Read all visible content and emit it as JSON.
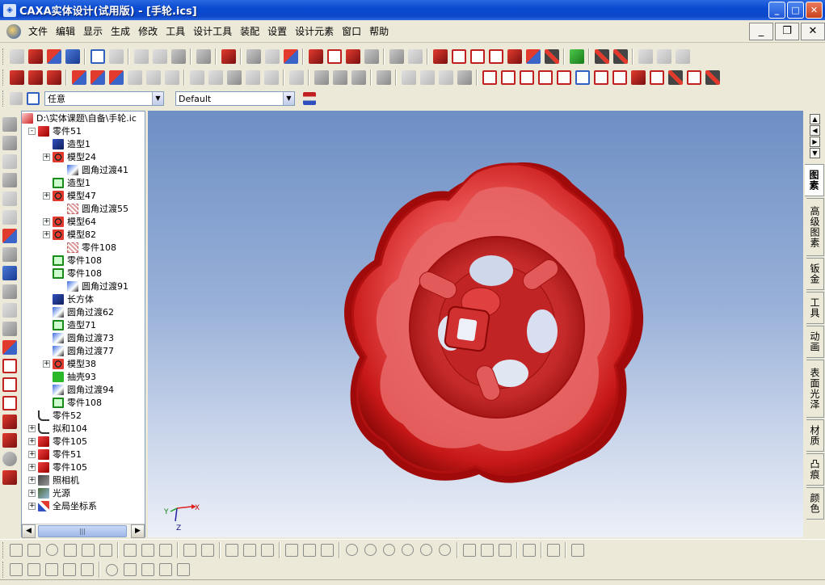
{
  "window": {
    "title": "CAXA实体设计(试用版) - [手轮.ics]",
    "app_icon": "caxa-app-icon",
    "controls": [
      "minimize",
      "maximize",
      "close"
    ]
  },
  "menu": {
    "items": [
      "文件",
      "编辑",
      "显示",
      "生成",
      "修改",
      "工具",
      "设计工具",
      "装配",
      "设置",
      "设计元素",
      "窗口",
      "帮助"
    ],
    "mdi_controls": [
      "minimize",
      "restore",
      "close"
    ]
  },
  "selectors": {
    "filter_value": "任意",
    "style_value": "Default"
  },
  "tree": {
    "root_label": "D:\\实体课题\\自备\\手轮.ic",
    "nodes": [
      {
        "label": "零件51",
        "icon": "part",
        "expand": "-"
      },
      {
        "label": "造型1",
        "icon": "proto",
        "expand": ""
      },
      {
        "label": "模型24",
        "icon": "model",
        "expand": "+"
      },
      {
        "label": "圆角过渡41",
        "icon": "fillet",
        "expand": ""
      },
      {
        "label": "造型1",
        "icon": "box",
        "expand": ""
      },
      {
        "label": "模型47",
        "icon": "model",
        "expand": "+"
      },
      {
        "label": "圆角过渡55",
        "icon": "fillet2",
        "expand": ""
      },
      {
        "label": "模型64",
        "icon": "model",
        "expand": "+"
      },
      {
        "label": "模型82",
        "icon": "model",
        "expand": "+"
      },
      {
        "label": "零件108",
        "icon": "fillet2",
        "expand": ""
      },
      {
        "label": "零件108",
        "icon": "box",
        "expand": ""
      },
      {
        "label": "零件108",
        "icon": "box",
        "expand": ""
      },
      {
        "label": "圆角过渡91",
        "icon": "fillet",
        "expand": ""
      },
      {
        "label": "长方体",
        "icon": "proto",
        "expand": ""
      },
      {
        "label": "圆角过渡62",
        "icon": "fillet",
        "expand": ""
      },
      {
        "label": "造型71",
        "icon": "box",
        "expand": ""
      },
      {
        "label": "圆角过渡73",
        "icon": "fillet",
        "expand": ""
      },
      {
        "label": "圆角过渡77",
        "icon": "fillet",
        "expand": ""
      },
      {
        "label": "模型38",
        "icon": "model",
        "expand": "+"
      },
      {
        "label": "抽壳93",
        "icon": "shell",
        "expand": ""
      },
      {
        "label": "圆角过渡94",
        "icon": "fillet",
        "expand": ""
      },
      {
        "label": "零件108",
        "icon": "box",
        "expand": ""
      },
      {
        "label": "零件52",
        "icon": "rel",
        "expand": ""
      },
      {
        "label": "拟和104",
        "icon": "rel",
        "expand": "+"
      },
      {
        "label": "零件105",
        "icon": "part",
        "expand": "+"
      },
      {
        "label": "零件51",
        "icon": "part",
        "expand": "+"
      },
      {
        "label": "零件105",
        "icon": "part",
        "expand": "+"
      },
      {
        "label": "照相机",
        "icon": "cam",
        "expand": "+"
      },
      {
        "label": "光源",
        "icon": "light",
        "expand": "+"
      },
      {
        "label": "全局坐标系",
        "icon": "coord",
        "expand": "+"
      }
    ]
  },
  "right_tabs": [
    "图素",
    "高级图素",
    "钣金",
    "工具",
    "动画",
    "表面光泽",
    "材质",
    "凸痕",
    "颜色"
  ],
  "active_right_tab": "图素",
  "viewport": {
    "axis_x": "X",
    "axis_y": "Y",
    "axis_z": "Z",
    "model_color": "#d41a1a"
  }
}
